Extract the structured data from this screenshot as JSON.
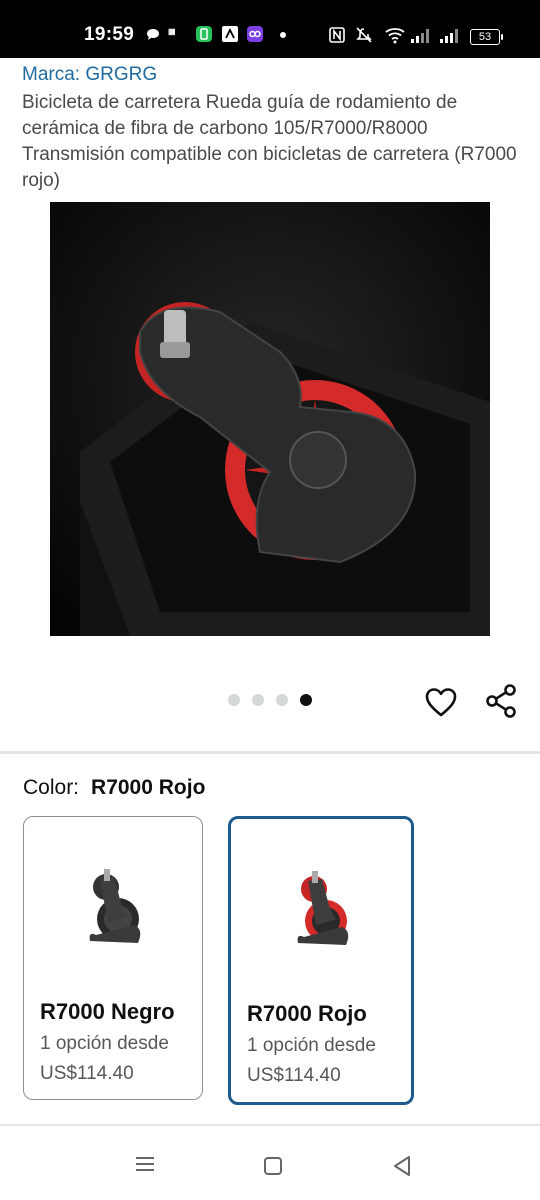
{
  "status_bar": {
    "time": "19:59",
    "battery": "53",
    "icons": [
      "chat-bubble-icon",
      "temu-icon",
      "app-icon",
      "a-icon",
      "link-icon",
      "dot-icon",
      "nfc-icon",
      "mute-icon",
      "wifi-icon",
      "signal-icon",
      "signal-icon-2"
    ]
  },
  "product": {
    "brand": "Marca: GRGRG",
    "title": "Bicicleta de carretera Rueda guía de rodamiento de cerámica de fibra de carbono 105/R7000/R8000 Transmisión compatible con bicicletas de carretera (R7000 rojo)",
    "image_count": 4,
    "active_image_index": 3
  },
  "actions": {
    "favorite_icon": "heart-icon",
    "share_icon": "share-icon"
  },
  "color_selector": {
    "label": "Color:",
    "selected_value": "R7000 Rojo",
    "options": [
      {
        "name": "R7000 Negro",
        "availability": "1 opción desde",
        "price": "US$114.40"
      },
      {
        "name": "R7000 Rojo",
        "availability": "1 opción desde",
        "price": "US$114.40"
      }
    ]
  },
  "colors": {
    "accent": "#1e5b8c",
    "brand_link": "#1f6aa0",
    "pulley_red": "#d42a2a"
  },
  "nav_bar": {
    "icons": [
      "menu-icon",
      "home-square-icon",
      "back-triangle-icon"
    ]
  }
}
